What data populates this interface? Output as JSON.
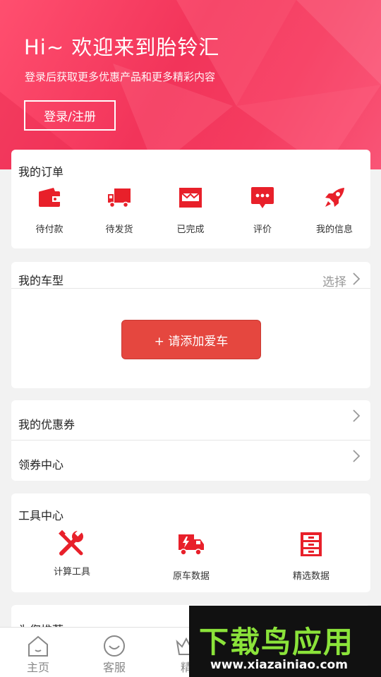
{
  "hero": {
    "title": "Hi~ 欢迎来到胎铃汇",
    "subtitle": "登录后获取更多优惠产品和更多精彩内容",
    "login_label": "登录/注册"
  },
  "orders": {
    "title": "我的订单",
    "items": [
      {
        "label": "待付款",
        "icon": "wallet-icon"
      },
      {
        "label": "待发货",
        "icon": "truck-icon"
      },
      {
        "label": "已完成",
        "icon": "box-icon"
      },
      {
        "label": "评价",
        "icon": "comment-icon"
      },
      {
        "label": "我的信息",
        "icon": "rocket-icon"
      }
    ]
  },
  "car": {
    "title": "我的车型",
    "select_label": "选择",
    "add_label": "+ 请添加爱车"
  },
  "coupons": {
    "my_coupons": "我的优惠券",
    "coupon_center": "领券中心"
  },
  "tools": {
    "title": "工具中心",
    "items": [
      {
        "label": "计算工具",
        "icon": "wrench-icon"
      },
      {
        "label": "原车数据",
        "icon": "car-data-icon"
      },
      {
        "label": "精选数据",
        "icon": "cabinet-icon"
      }
    ]
  },
  "recommend": {
    "title": "为您推荐"
  },
  "bottom_nav": {
    "items": [
      {
        "label": "主页",
        "icon": "home-icon"
      },
      {
        "label": "客服",
        "icon": "service-icon"
      },
      {
        "label": "精",
        "icon": "crown-icon"
      }
    ]
  },
  "watermark": {
    "main": "下载鸟应用",
    "url": "www.xiazainiao.com"
  },
  "colors": {
    "accent": "#e5473f",
    "icon_red": "#e8202a",
    "hero_pink": "#f2345a"
  }
}
